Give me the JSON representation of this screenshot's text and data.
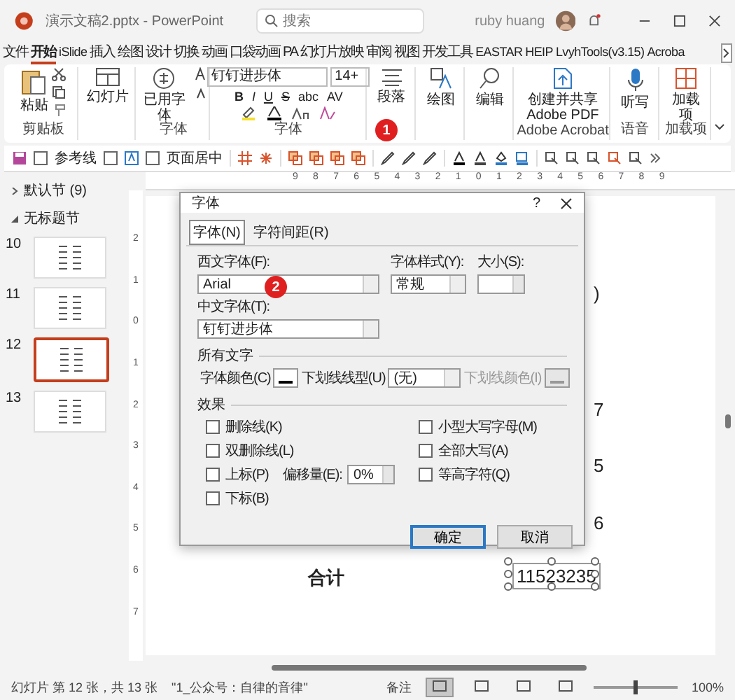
{
  "window": {
    "title": "演示文稿2.pptx - PowerPoint",
    "search_placeholder": "搜索",
    "user": "ruby huang"
  },
  "tabs": [
    {
      "label": "文件",
      "selected": false
    },
    {
      "label": "开始",
      "selected": true
    },
    {
      "label": "iSlide",
      "selected": false
    },
    {
      "label": "插入",
      "selected": false
    },
    {
      "label": "绘图",
      "selected": false
    },
    {
      "label": "设计",
      "selected": false
    },
    {
      "label": "切换",
      "selected": false
    },
    {
      "label": "动画",
      "selected": false
    },
    {
      "label": "口袋动画 PA",
      "selected": false
    },
    {
      "label": "幻灯片放映",
      "selected": false
    },
    {
      "label": "审阅",
      "selected": false
    },
    {
      "label": "视图",
      "selected": false
    },
    {
      "label": "开发工具",
      "selected": false
    },
    {
      "label": "EASTAR",
      "selected": false
    },
    {
      "label": "HEIP",
      "selected": false
    },
    {
      "label": "LvyhTools(v3.15)",
      "selected": false
    },
    {
      "label": "Acroba",
      "selected": false
    }
  ],
  "ribbon": {
    "paste": "粘贴",
    "clipboard_label": "剪贴板",
    "new_slide": "幻灯片",
    "used_fonts": "已用字体",
    "used_fonts_label": "字体",
    "font_name": "钉钉进步体",
    "font_size": "14+",
    "format": [
      "B",
      "I",
      "U",
      "S",
      "abc",
      "AV"
    ],
    "font_label": "字体",
    "paragraph": "段落",
    "drawing": "绘图",
    "editing": "编辑",
    "acrobat_button": "创建并共享 Adobe PDF",
    "acrobat_label": "Adobe Acrobat",
    "voice_button": "听写",
    "voice_label": "语音",
    "addins_button": "加载项",
    "addins_label": "加载项"
  },
  "quickbar": {
    "guides": {
      "label": "参考线",
      "checked": false
    },
    "plain_checkbox": {
      "checked": false
    },
    "center": {
      "label": "页面居中",
      "checked": false
    }
  },
  "step_badges": [
    "1",
    "2"
  ],
  "sidebar": {
    "sections": [
      {
        "label": "默认节 (9)",
        "expanded": false
      },
      {
        "label": "无标题节",
        "expanded": true
      }
    ],
    "slides": [
      {
        "number": "10",
        "selected": false
      },
      {
        "number": "11",
        "selected": false
      },
      {
        "number": "12",
        "selected": true
      },
      {
        "number": "13",
        "selected": false
      }
    ]
  },
  "ruler": {
    "horizontal": [
      "9",
      "8",
      "7",
      "6",
      "5",
      "4",
      "3",
      "2",
      "1",
      "0",
      "1",
      "2",
      "3",
      "4",
      "5",
      "6",
      "7",
      "8",
      "9"
    ],
    "vertical": [
      "2",
      "1",
      "0",
      "1",
      "2",
      "3",
      "4",
      "5",
      "6",
      "7"
    ]
  },
  "slide": {
    "fragments": [
      ")",
      "7",
      "5",
      "6"
    ],
    "total_label": "合计",
    "total_value": "11523235"
  },
  "dialog": {
    "title": "字体",
    "help": "?",
    "tabs": [
      {
        "label": "字体(N)",
        "selected": true
      },
      {
        "label": "字符间距(R)",
        "selected": false
      }
    ],
    "latin_font": {
      "label": "西文字体(F):",
      "value": "Arial"
    },
    "style": {
      "label": "字体样式(Y):",
      "value": "常规"
    },
    "size": {
      "label": "大小(S):"
    },
    "cjk_font": {
      "label": "中文字体(T):",
      "value": "钉钉进步体"
    },
    "all_text": "所有文字",
    "font_color": "字体颜色(C)",
    "underline_style": {
      "label": "下划线线型(U)",
      "value": "(无)"
    },
    "underline_color": {
      "label": "下划线颜色(I)",
      "disabled": true
    },
    "effects_label": "效果",
    "effects_left": [
      {
        "label": "删除线(K)",
        "checked": false
      },
      {
        "label": "双删除线(L)",
        "checked": false
      },
      {
        "label": "上标(P)",
        "checked": false
      },
      {
        "label": "下标(B)",
        "checked": false
      }
    ],
    "effects_right": [
      {
        "label": "小型大写字母(M)",
        "checked": false
      },
      {
        "label": "全部大写(A)",
        "checked": false
      },
      {
        "label": "等高字符(Q)",
        "checked": false
      }
    ],
    "offset": {
      "label": "偏移量(E):",
      "value": "0%"
    },
    "buttons": [
      {
        "label": "确定",
        "default": true
      },
      {
        "label": "取消",
        "default": false
      }
    ]
  },
  "status": {
    "slide_info": "幻灯片 第 12 张，共 13 张",
    "theme": "\"1_公众号：自律的音律\"",
    "notes": "备注",
    "views": [
      {
        "selected": true
      },
      {
        "selected": false
      },
      {
        "selected": false
      },
      {
        "selected": false
      }
    ],
    "zoom_slider": {
      "level": 0.5
    },
    "zoom": "100%"
  }
}
